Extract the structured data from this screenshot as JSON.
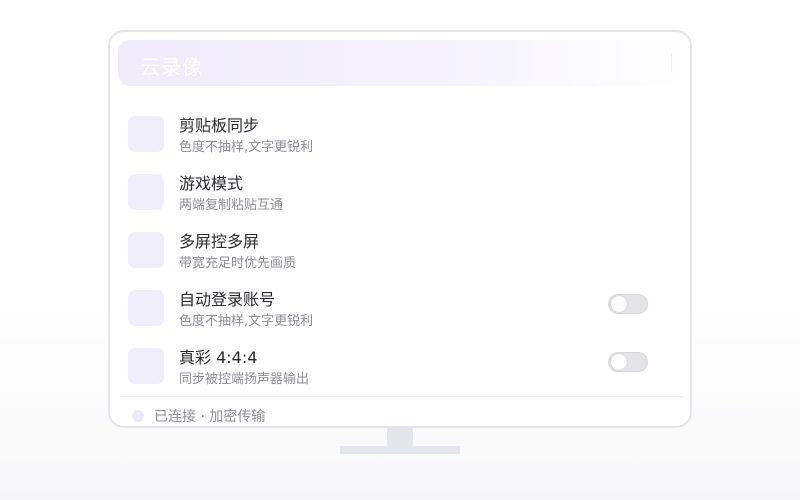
{
  "header": {
    "title": "云录像"
  },
  "items": [
    {
      "title": "剪贴板同步",
      "subtitle": "色度不抽样,文字更锐利",
      "toggle": null
    },
    {
      "title": "游戏模式",
      "subtitle": "两端复制粘贴互通",
      "toggle": null
    },
    {
      "title": "多屏控多屏",
      "subtitle": "带宽充足时优先画质",
      "toggle": null
    },
    {
      "title": "自动登录账号",
      "subtitle": "色度不抽样,文字更锐利",
      "toggle": false
    },
    {
      "title": "真彩 4:4:4",
      "subtitle": "同步被控端扬声器输出",
      "toggle": false
    }
  ],
  "footer": {
    "status": "已连接 · 加密传输"
  },
  "colors": {
    "accent": "#f1eefc",
    "toggle_off": "#e4e4e8"
  }
}
